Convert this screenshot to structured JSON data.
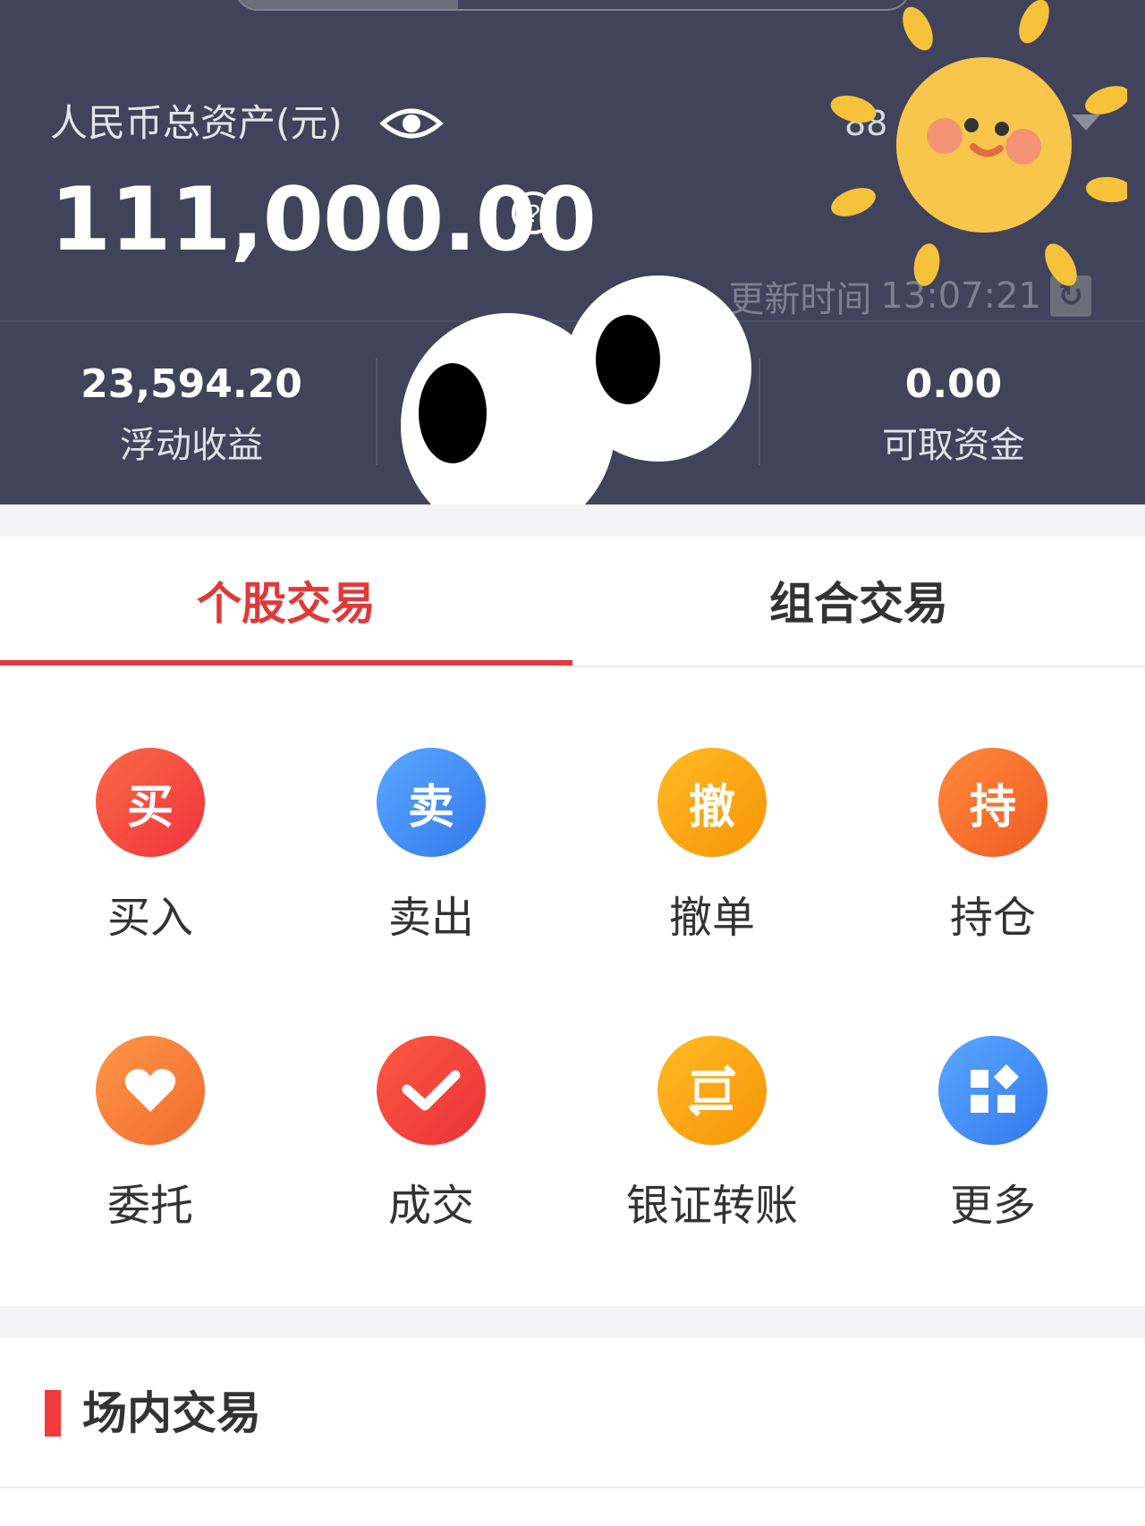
{
  "header": {
    "asset_label": "人民币总资产(元)",
    "total_assets": "111,000.00",
    "account_partial": "88",
    "update_label": "更新时间",
    "update_time": "13:07:21",
    "stats": [
      {
        "value": "23,594.20",
        "label": "浮动收益"
      },
      {
        "value": "",
        "label": ""
      },
      {
        "value": "0.00",
        "label": "可取资金"
      }
    ]
  },
  "tabs": [
    {
      "label": "个股交易",
      "active": true
    },
    {
      "label": "组合交易",
      "active": false
    }
  ],
  "actions": [
    {
      "glyph": "买",
      "label": "买入",
      "color": "#f2453d",
      "icon": "buy-icon"
    },
    {
      "glyph": "卖",
      "label": "卖出",
      "color": "#3f8ef5",
      "icon": "sell-icon"
    },
    {
      "glyph": "撤",
      "label": "撤单",
      "color": "#f9a20f",
      "icon": "cancel-order-icon"
    },
    {
      "glyph": "持",
      "label": "持仓",
      "color": "#f66b2e",
      "icon": "position-icon"
    },
    {
      "glyph": "",
      "label": "委托",
      "color": "#f7773a",
      "icon": "heart-icon"
    },
    {
      "glyph": "",
      "label": "成交",
      "color": "#f2453d",
      "icon": "check-icon"
    },
    {
      "glyph": "",
      "label": "银证转账",
      "color": "#f9a20f",
      "icon": "transfer-icon"
    },
    {
      "glyph": "",
      "label": "更多",
      "color": "#3f8ef5",
      "icon": "more-grid-icon"
    }
  ],
  "section": {
    "title": "场内交易"
  },
  "colors": {
    "header_bg": "#40435a",
    "accent_red": "#e0393b"
  }
}
